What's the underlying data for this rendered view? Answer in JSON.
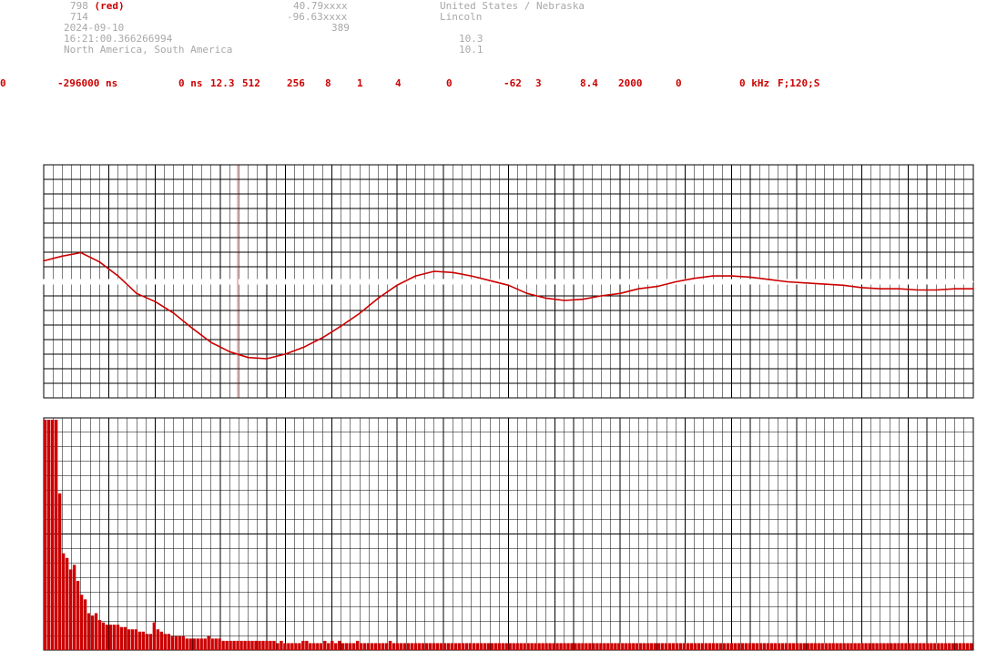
{
  "header": {
    "stroke_id": "798",
    "stroke_color_label": "(red)",
    "stations": "714",
    "date": "2024-09-10",
    "time": "16:21:00.366266994",
    "region": "North America, South America",
    "lat": "40.79xxxx",
    "lon": "-96.63xxxx",
    "alt": "389",
    "country_state": "United States / Nebraska",
    "city": "Lincoln",
    "val1": "10.3",
    "val2": "10.1"
  },
  "params": [
    "0",
    "-296000 ns",
    "0 ns",
    "12.3",
    "512",
    "256",
    "8",
    "1",
    "4",
    "0",
    "-62",
    "3",
    "8.4",
    "2000",
    "0",
    "0 kHz",
    "F;120;S"
  ],
  "colors": {
    "trace": "#cc0000",
    "grid": "#000000",
    "background": "#ffffff"
  },
  "chart_data": [
    {
      "type": "line",
      "description_role": "waveform",
      "x": [
        0,
        10,
        20,
        30,
        40,
        50,
        60,
        70,
        80,
        90,
        100,
        110,
        120,
        130,
        140,
        150,
        160,
        170,
        180,
        190,
        200,
        210,
        220,
        230,
        240,
        250,
        260,
        270,
        280,
        290,
        300,
        310,
        320,
        330,
        340,
        350,
        360,
        370,
        380,
        390,
        400,
        410,
        420,
        430,
        440,
        450,
        460,
        470,
        480,
        490,
        500
      ],
      "y": [
        0.18,
        0.22,
        0.25,
        0.17,
        0.05,
        -0.1,
        -0.17,
        -0.27,
        -0.4,
        -0.52,
        -0.6,
        -0.65,
        -0.66,
        -0.62,
        -0.56,
        -0.48,
        -0.38,
        -0.27,
        -0.14,
        -0.03,
        0.05,
        0.09,
        0.08,
        0.05,
        0.01,
        -0.03,
        -0.1,
        -0.14,
        -0.16,
        -0.15,
        -0.12,
        -0.1,
        -0.06,
        -0.04,
        0.0,
        0.03,
        0.05,
        0.05,
        0.04,
        0.02,
        0.0,
        -0.01,
        -0.02,
        -0.03,
        -0.05,
        -0.06,
        -0.06,
        -0.07,
        -0.07,
        -0.06,
        -0.06
      ],
      "ylim": [
        -1,
        1
      ]
    },
    {
      "type": "bar",
      "description_role": "spectrum",
      "values": [
        100,
        100,
        100,
        100,
        68,
        42,
        40,
        35,
        37,
        30,
        24,
        22,
        16,
        15,
        16,
        13,
        12,
        11,
        11,
        11,
        11,
        10,
        10,
        9,
        9,
        9,
        8,
        8,
        7,
        7,
        12,
        9,
        8,
        7,
        7,
        6,
        6,
        6,
        6,
        5,
        5,
        5,
        5,
        5,
        5,
        6,
        5,
        5,
        5,
        4,
        4,
        4,
        4,
        4,
        4,
        4,
        4,
        4,
        4,
        4,
        4,
        4,
        4,
        4,
        3,
        4,
        3,
        3,
        3,
        3,
        3,
        4,
        4,
        3,
        3,
        3,
        3,
        4,
        3,
        4,
        3,
        4,
        3,
        3,
        3,
        3,
        4,
        3,
        3,
        3,
        3,
        3,
        3,
        3,
        3,
        4,
        3,
        3,
        3,
        3,
        3,
        3,
        3,
        3,
        3,
        3,
        3,
        3,
        3,
        3,
        3,
        3,
        3,
        3,
        3,
        3,
        3,
        3,
        3,
        3,
        3,
        3,
        3,
        3,
        3,
        3,
        3,
        3,
        3,
        3,
        3,
        3,
        3,
        3,
        3,
        3,
        3,
        3,
        3,
        3,
        3,
        3,
        3,
        3,
        3,
        3,
        3,
        3,
        3,
        3,
        3,
        3,
        3,
        3,
        3,
        3,
        3,
        3,
        3,
        3,
        3,
        3,
        3,
        3,
        3,
        3,
        3,
        3,
        3,
        3,
        3,
        3,
        3,
        3,
        3,
        3,
        3,
        3,
        3,
        3,
        3,
        3,
        3,
        3,
        3,
        3,
        3,
        3,
        3,
        3,
        3,
        3,
        3,
        3,
        3,
        3,
        3,
        3,
        3,
        3,
        3,
        3,
        3,
        3,
        3,
        3,
        3,
        3,
        3,
        3,
        3,
        3,
        3,
        3,
        3,
        3,
        3,
        3,
        3,
        3,
        3,
        3,
        3,
        3,
        3,
        3,
        3,
        3,
        3,
        3,
        3,
        3,
        3,
        3,
        3,
        3,
        3,
        3,
        3,
        3,
        3,
        3,
        3,
        3,
        3,
        3,
        3,
        3,
        3,
        3,
        3,
        3,
        3,
        3,
        3,
        3
      ],
      "ylim": [
        0,
        100
      ]
    }
  ]
}
